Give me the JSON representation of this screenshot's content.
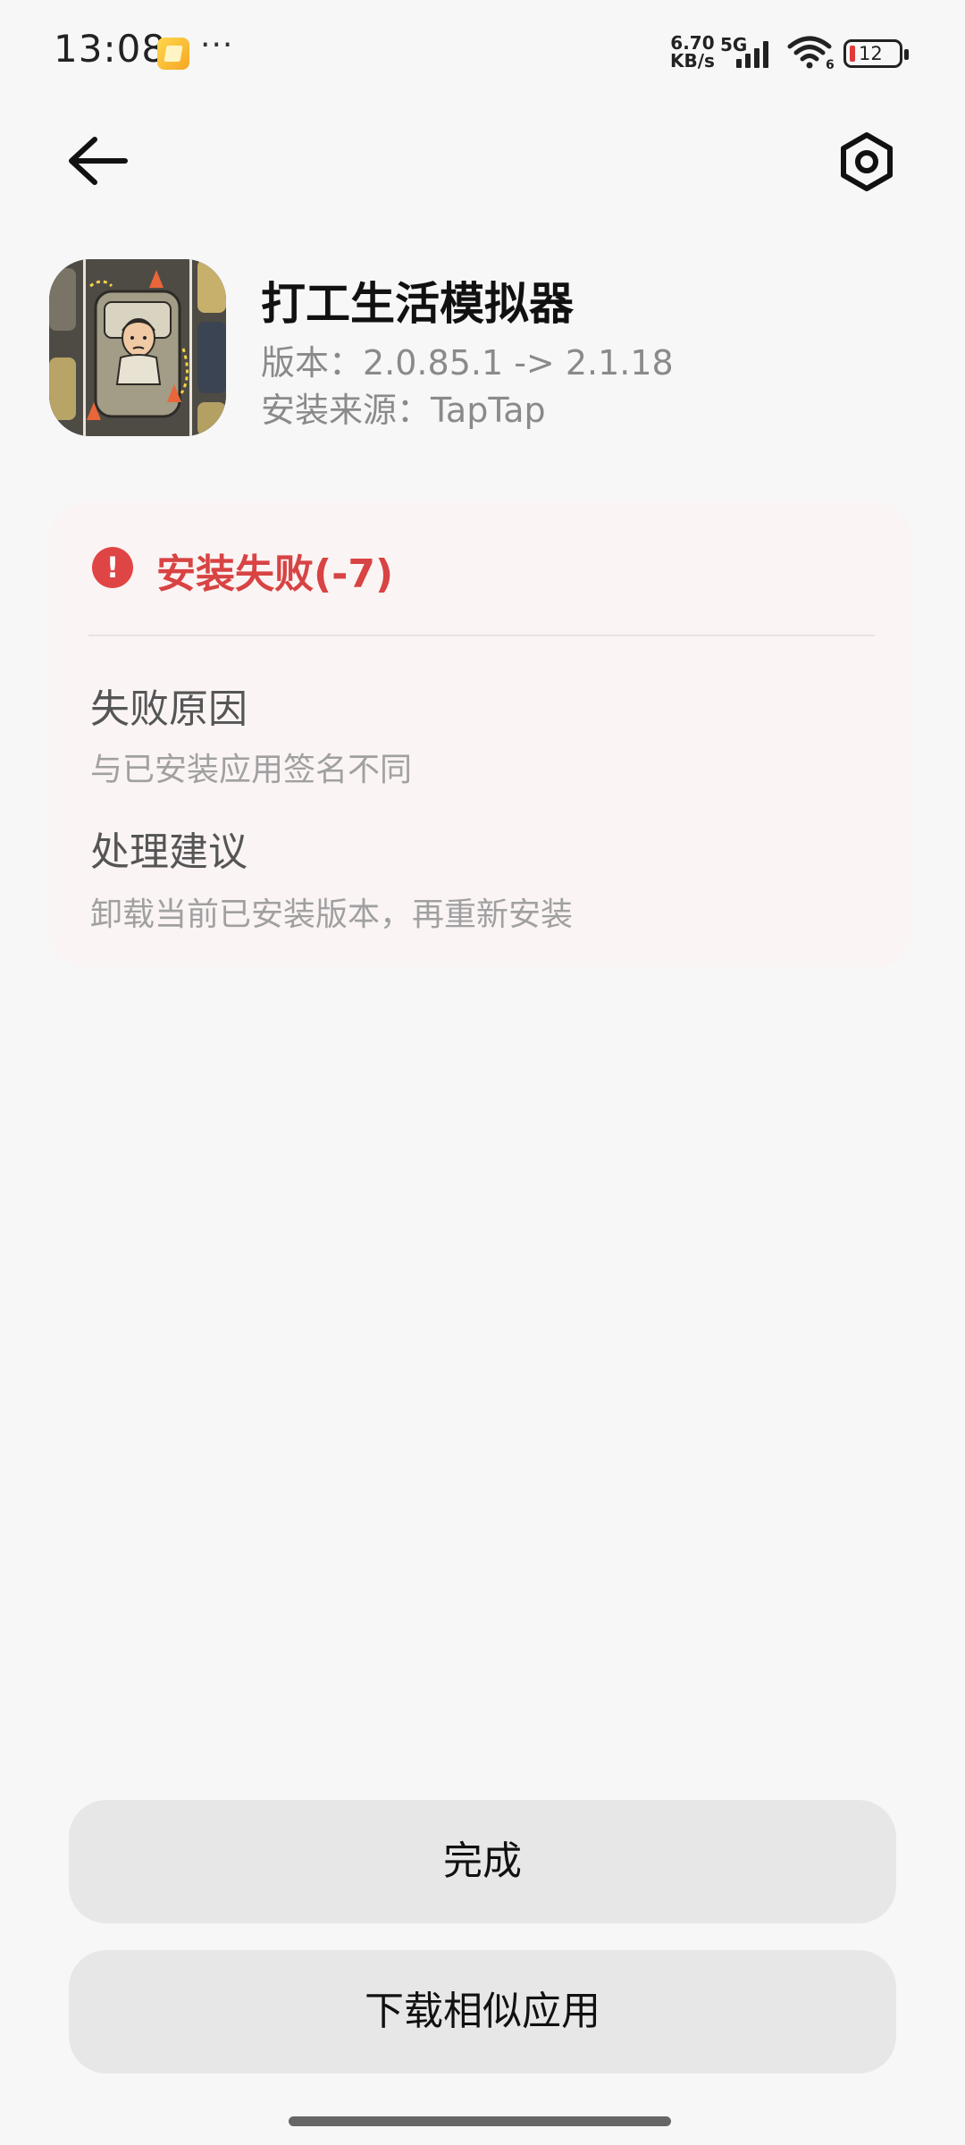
{
  "status_bar": {
    "time": "13:08",
    "more": "···",
    "speed_value": "6.70",
    "speed_unit": "KB/s",
    "network": "5G",
    "wifi_badge": "6",
    "battery": "12",
    "battery_color": "#e03a3a"
  },
  "top_bar": {
    "back_icon": "arrow-left-icon",
    "settings_icon": "hexagon-settings-icon"
  },
  "app": {
    "name": "打工生活模拟器",
    "version": "版本：2.0.85.1 -> 2.1.18",
    "source": "安装来源：TapTap"
  },
  "error": {
    "title": "安装失败(-7)",
    "icon": "exclamation-circle-icon",
    "color": "#d84343",
    "reason_label": "失败原因",
    "reason_text": "与已安装应用签名不同",
    "advice_label": "处理建议",
    "advice_text": "卸载当前已安装版本，再重新安装"
  },
  "actions": {
    "done": "完成",
    "download_similar": "下载相似应用"
  }
}
